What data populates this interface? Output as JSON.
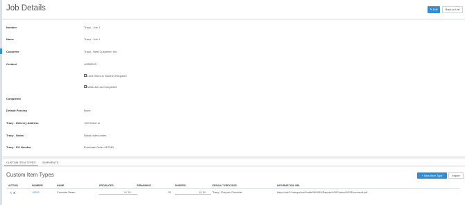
{
  "header": {
    "title": "Job Details",
    "edit_label": "Edit",
    "back_label": "Back to List",
    "edit_icon": "pencil-icon"
  },
  "details": {
    "number": {
      "label": "Number",
      "value": "Tracy - Job 1"
    },
    "name": {
      "label": "Name",
      "value": "Tracy - Job 1"
    },
    "customer": {
      "label": "Customer",
      "value": "Tracy - Best Customer, Inc."
    },
    "created": {
      "label": "Created",
      "value": "4/28/2020"
    },
    "limit_items": {
      "label": "Limit Items to Number Required",
      "checked": true
    },
    "mark_completed": {
      "label": "Mark Job as Completed",
      "checked": false
    },
    "completed": {
      "label": "Completed",
      "value": ""
    },
    "default_process": {
      "label": "Default Process",
      "value": "None"
    },
    "delivery_address": {
      "label": "Tracy - Delivery Address",
      "value": "123 Street st"
    },
    "notes": {
      "label": "Tracy - Notes",
      "value": "Notes notes notes"
    },
    "po_number": {
      "label": "Tracy - PO Number",
      "value": "Purchase Order #12345"
    }
  },
  "tabs": [
    {
      "label": "CUSTOM ITEM TYPES",
      "active": true
    },
    {
      "label": "SHIPMENTS",
      "active": false
    }
  ],
  "items": {
    "title": "Custom Item Types",
    "new_label": "+ New Item Type",
    "import_label": "Import",
    "columns": [
      "ACTION",
      "NUMBER",
      "NAME",
      "PRODUCED",
      "REMAINING",
      "SHIPPED",
      "DEFAULT PROCESS",
      "INFORMATION URL"
    ],
    "rows": [
      {
        "number": "12345",
        "name": "Concrete Beam",
        "produced": "0 / 10",
        "remaining": "10",
        "shipped": "0 / 10",
        "default_process": "Tracy - Prepour Checklist",
        "information_url": "https://cdn2.hubspot.net/hubfs/361853/Sample%20Product%20Document.pdf"
      }
    ]
  },
  "colors": {
    "accent": "#2d8ed4",
    "background": "#eef0f2"
  }
}
